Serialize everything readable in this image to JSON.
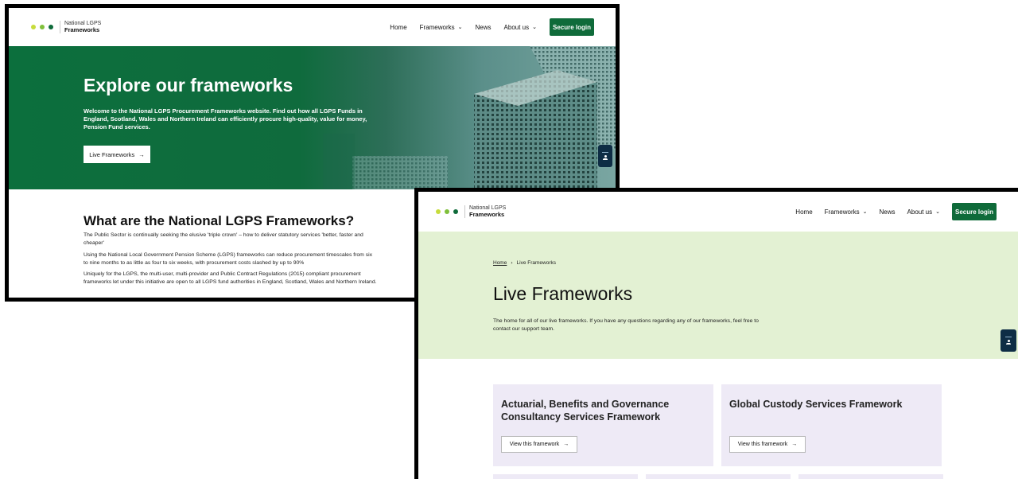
{
  "logo": {
    "line1": "National LGPS",
    "line2": "Frameworks",
    "dot_colors": [
      "#c7dc3c",
      "#7fbf3a",
      "#0f6b3a"
    ]
  },
  "nav": {
    "home": "Home",
    "frameworks": "Frameworks",
    "news": "News",
    "about": "About us",
    "login": "Secure login"
  },
  "colors": {
    "brand_green": "#0f6b3a",
    "hero2_bg": "#e3f1d3",
    "card_bg": "#eeeaf6",
    "widget": "#0e2d45"
  },
  "icons": [
    "chevron-down-icon",
    "arrow-right-icon",
    "accessibility-widget-icon"
  ],
  "home_page": {
    "hero": {
      "title": "Explore our frameworks",
      "text": "Welcome to the National LGPS Procurement Frameworks website. Find out how all LGPS Funds in England, Scotland, Wales and Northern Ireland can efficiently procure high-quality, value for money, Pension Fund services.",
      "button": "Live Frameworks"
    },
    "section": {
      "title": "What are the National LGPS Frameworks?",
      "p1": "The Public Sector is continually seeking the elusive 'triple crown' – how to deliver statutory services 'better, faster and cheaper'",
      "p2": "Using the National Local Government Pension Scheme (LGPS) frameworks can reduce procurement timescales from six to nine months to as little as four to six weeks, with procurement costs slashed by up to 90%",
      "p3": "Uniquely for the LGPS, the multi-user, multi-provider and Public Contract Regulations (2015) compliant procurement frameworks let under this initiative are open to all LGPS fund authorities in England, Scotland, Wales and Northern Ireland."
    }
  },
  "live_page": {
    "breadcrumb": {
      "home": "Home",
      "separator": "›",
      "current": "Live Frameworks"
    },
    "title": "Live Frameworks",
    "text": "The home for all of our live frameworks. If you have any questions regarding any of our frameworks, feel free to contact our support team.",
    "cards": [
      {
        "title": "Actuarial, Benefits and Governance Consultancy Services Framework",
        "button": "View this framework"
      },
      {
        "title": "Global Custody Services Framework",
        "button": "View this framework"
      }
    ]
  }
}
